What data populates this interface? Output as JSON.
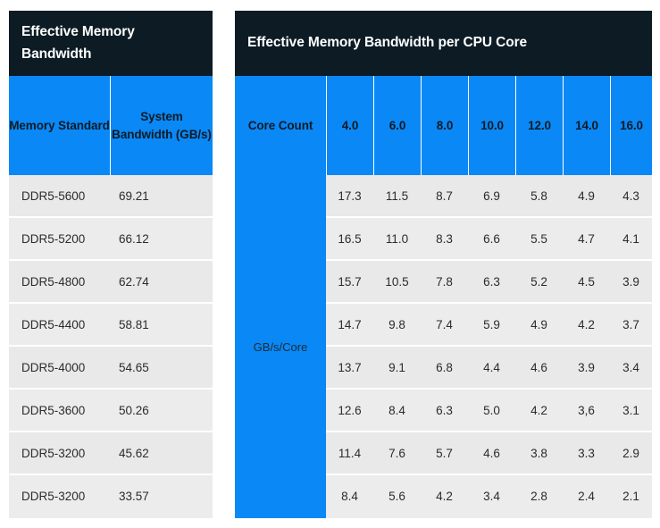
{
  "table": {
    "left_group": {
      "title": "Effective Memory Bandwidth",
      "columns": [
        {
          "label": "Memory Standard"
        },
        {
          "label": "System Bandwidth (GB/s)"
        }
      ],
      "rows": [
        {
          "standard": "DDR5-5600",
          "bandwidth": "69.21"
        },
        {
          "standard": "DDR5-5200",
          "bandwidth": "66.12"
        },
        {
          "standard": "DDR5-4800",
          "bandwidth": "62.74"
        },
        {
          "standard": "DDR5-4400",
          "bandwidth": "58.81"
        },
        {
          "standard": "DDR5-4000",
          "bandwidth": "54.65"
        },
        {
          "standard": "DDR5-3600",
          "bandwidth": "50.26"
        },
        {
          "standard": "DDR5-3200",
          "bandwidth": "45.62"
        },
        {
          "standard": "DDR5-3200",
          "bandwidth": "33.57"
        }
      ]
    },
    "right_group": {
      "title": "Effective Memory Bandwidth per CPU Core",
      "core_count_label": "Core Count",
      "unit_label": "GB/s/Core",
      "core_counts": [
        "4.0",
        "6.0",
        "8.0",
        "10.0",
        "12.0",
        "14.0",
        "16.0"
      ],
      "rows": [
        [
          "17.3",
          "11.5",
          "8.7",
          "6.9",
          "5.8",
          "4.9",
          "4.3"
        ],
        [
          "16.5",
          "11.0",
          "8.3",
          "6.6",
          "5.5",
          "4.7",
          "4.1"
        ],
        [
          "15.7",
          "10.5",
          "7.8",
          "6.3",
          "5.2",
          "4.5",
          "3.9"
        ],
        [
          "14.7",
          "9.8",
          "7.4",
          "5.9",
          "4.9",
          "4.2",
          "3.7"
        ],
        [
          "13.7",
          "9.1",
          "6.8",
          "4.4",
          "4.6",
          "3.9",
          "3.4"
        ],
        [
          "12.6",
          "8.4",
          "6.3",
          "5.0",
          "4.2",
          "3,6",
          "3.1"
        ],
        [
          "11.4",
          "7.6",
          "5.7",
          "4.6",
          "3.8",
          "3.3",
          "2.9"
        ],
        [
          "8.4",
          "5.6",
          "4.2",
          "3.4",
          "2.8",
          "2.4",
          "2.1"
        ]
      ]
    }
  },
  "colors": {
    "header_dark": "#0c1b24",
    "accent_blue": "#0a88f5",
    "row_bg": "#e9e9e9",
    "row_bg_alt": "#ececec",
    "page_bg": "#ffffff"
  }
}
